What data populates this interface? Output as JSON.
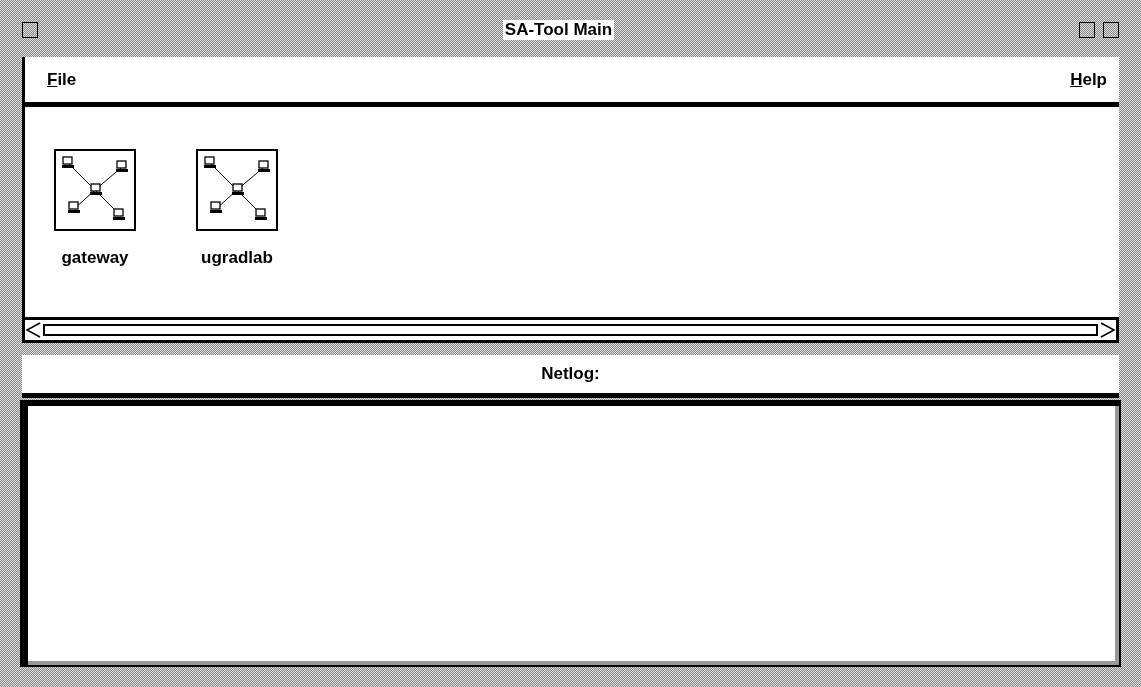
{
  "window": {
    "title": "SA-Tool Main"
  },
  "menu_bar": [
    {
      "label": "File"
    },
    {
      "label": "Help"
    }
  ],
  "hosts": [
    {
      "label": "gateway"
    },
    {
      "label": "ugradlab"
    }
  ],
  "netlog": {
    "label": "Netlog:"
  }
}
